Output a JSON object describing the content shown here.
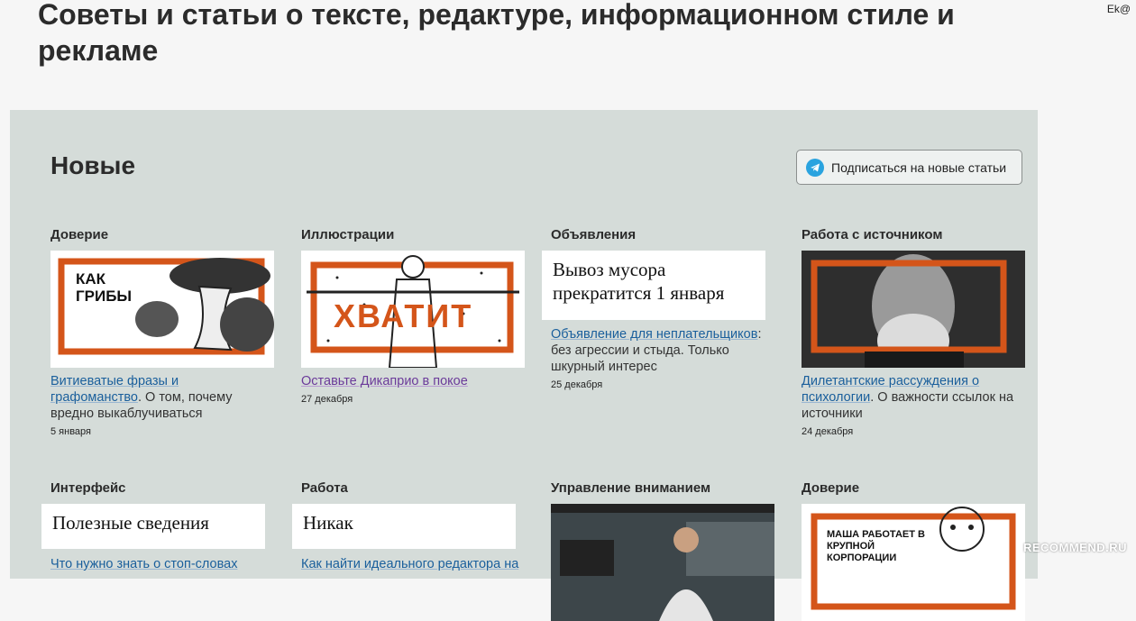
{
  "header": {
    "title": "Советы и статьи о тексте, редактуре, информационном стиле и рекламе",
    "topright": "Ek@"
  },
  "section": {
    "title": "Новые",
    "subscribe_label": "Подписаться на новые статьи"
  },
  "cards": [
    {
      "category": "Доверие",
      "image_text": "КАК ГРИБЫ",
      "link": "Витиеватые фразы и графоманство",
      "desc": ". О том, почему вредно выкаблучиваться",
      "date": "5 января"
    },
    {
      "category": "Иллюстрации",
      "image_text": "ХВАТИТ",
      "link": "Оставьте Дикаприо в покое",
      "desc": "",
      "date": "27 декабря"
    },
    {
      "category": "Объявления",
      "image_text": "Вывоз мусора прекратится 1 января",
      "link": "Объявление для неплательщиков",
      "desc": ": без агрессии и стыда. Только шкурный интерес",
      "date": "25 декабря"
    },
    {
      "category": "Работа с источником",
      "link": "Дилетантские рассуждения о психологии",
      "desc": ". О важности ссылок на источники",
      "date": "24 декабря"
    },
    {
      "category": "Интерфейс",
      "image_text": "Полезные сведения",
      "link": "Что нужно знать о стоп-словах"
    },
    {
      "category": "Работа",
      "image_text": "Никак",
      "link": "Как найти идеального редактора на"
    },
    {
      "category": "Управление вниманием"
    },
    {
      "category": "Доверие",
      "image_text": "МАША РАБОТАЕТ В КРУПНОЙ КОРПОРАЦИИ"
    }
  ],
  "watermark": "RECOMMEND.RU",
  "colors": {
    "accent_orange": "#d4551a",
    "link_blue": "#1a5f9c",
    "panel_bg": "#d5dcd9",
    "telegram": "#2aa3df"
  }
}
